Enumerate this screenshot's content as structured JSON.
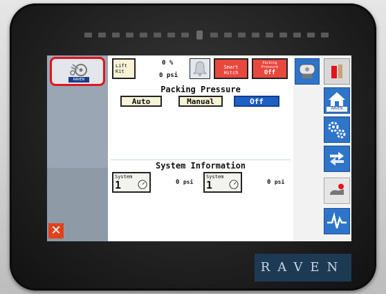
{
  "header": {
    "lift_kit_label": "Lift Kit",
    "lift_percent": "0 %",
    "lift_pressure": "0 psi",
    "smart_hitch_label": "Smart Hitch",
    "packing_pressure_btn": {
      "line1": "Packing",
      "line2": "Pressure",
      "state": "Off"
    }
  },
  "packing_pressure": {
    "title": "Packing Pressure",
    "modes": [
      "Auto",
      "Manual",
      "Off"
    ],
    "active_mode": "Off"
  },
  "system_information": {
    "title": "System Information",
    "systems": [
      {
        "label": "System",
        "number": "1",
        "value": "0",
        "unit": "psi"
      },
      {
        "label": "System",
        "number": "1",
        "value": "0",
        "unit": "psi"
      }
    ]
  },
  "branding": {
    "tile_logo_text": "RAVEN",
    "home_badge": "RAVEN",
    "bezel_logo": "RAVEN"
  },
  "colors": {
    "accent_red": "#e9483f",
    "highlight_red": "#e2141b",
    "nav_blue": "#2e74c9",
    "active_blue": "#1f5fc4"
  },
  "icons": [
    "tractor-icon",
    "bell-icon",
    "sprayer-icon",
    "home-icon",
    "gears-icon",
    "arrows-swap-icon",
    "hand-icon",
    "pulse-icon",
    "close-icon",
    "gauge-icon"
  ]
}
